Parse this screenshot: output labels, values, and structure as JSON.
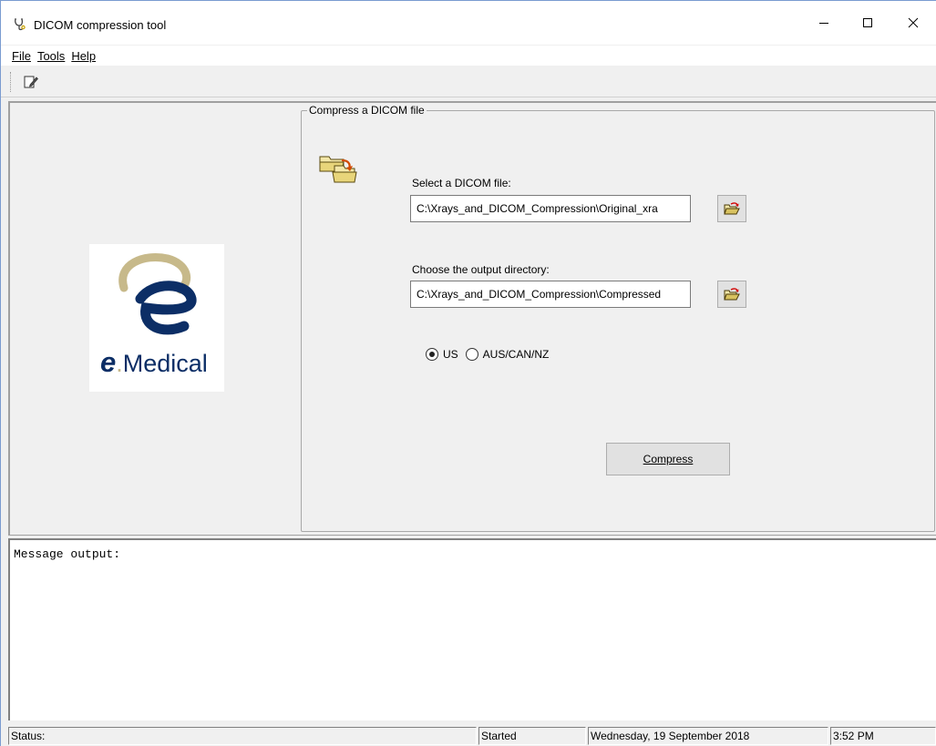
{
  "window": {
    "title": "DICOM compression tool"
  },
  "menu": {
    "file": "File",
    "tools": "Tools",
    "help": "Help"
  },
  "logo": {
    "e": "e",
    "dot": ".",
    "medical": "Medical"
  },
  "group": {
    "legend": "Compress a DICOM file",
    "select_label": "Select a DICOM file:",
    "select_value": "C:\\Xrays_and_DICOM_Compression\\Original_xra",
    "output_label": "Choose the output directory:",
    "output_value": "C:\\Xrays_and_DICOM_Compression\\Compressed",
    "region_options": [
      {
        "label": "US",
        "checked": true
      },
      {
        "label": "AUS/CAN/NZ",
        "checked": false
      }
    ],
    "compress_label": "Compress"
  },
  "messages": {
    "text": "Message output:"
  },
  "status": {
    "label": "Status:",
    "state": "Started",
    "date": "Wednesday, 19 September 2018",
    "time": "3:52 PM"
  },
  "colors": {
    "logo_navy": "#0c2e66",
    "logo_gold": "#c7b98a"
  }
}
